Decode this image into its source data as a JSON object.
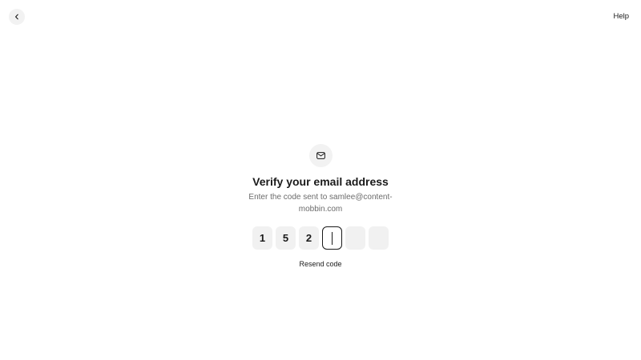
{
  "header": {
    "back_icon": "chevron-left-icon",
    "help_label": "Help"
  },
  "verify": {
    "mail_icon": "mail-icon",
    "title": "Verify your email address",
    "subtitle": "Enter the code sent to samlee@content-mobbin.com",
    "code_digits": [
      "1",
      "5",
      "2",
      "",
      "",
      ""
    ],
    "active_index": 3,
    "resend_label": "Resend code"
  },
  "colors": {
    "background": "#ffffff",
    "text": "#1a1a1a",
    "muted_text": "#6b6b6b",
    "box_fill": "#f1f1f1"
  }
}
